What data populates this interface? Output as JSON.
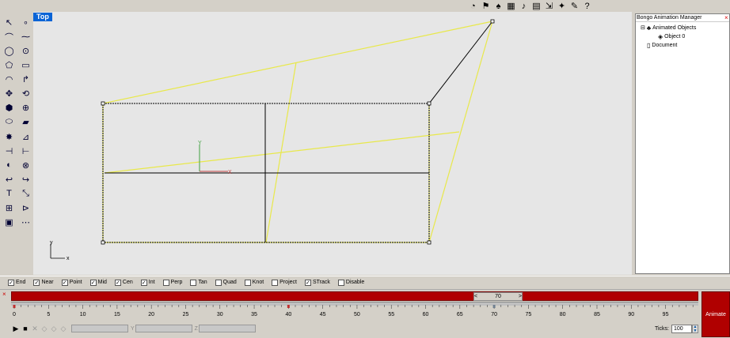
{
  "top_toolbar": {
    "icons": [
      "time-icon",
      "flag-icon",
      "camera-icon",
      "graph-icon",
      "sound-icon",
      "film-icon",
      "export-icon",
      "render-icon",
      "tools-icon",
      "help-icon"
    ],
    "glyphs": [
      "◔",
      "⚑",
      "♠",
      "▦",
      "♪",
      "▤",
      "⇲",
      "✦",
      "✎",
      "?"
    ]
  },
  "left_toolbar": {
    "icons": [
      "select-arrow-icon",
      "point-icon",
      "polyline-icon",
      "curve-points-icon",
      "circle-icon",
      "ellipse-icon",
      "polygon-icon",
      "rectangle-icon",
      "arc-icon",
      "fillet-icon",
      "move-icon",
      "rotate-icon",
      "box-icon",
      "union-icon",
      "cylinder-icon",
      "extrude-icon",
      "explode-icon",
      "dimension-icon",
      "trim-icon",
      "split-icon",
      "analyze-icon",
      "offset-icon",
      "curve-icon",
      "blend-icon",
      "text-icon",
      "transform-icon",
      "array-icon",
      "mirror-icon",
      "layer-icon",
      "grid-snap-icon"
    ],
    "glyphs": [
      "↖",
      "∘",
      "⌒",
      "⁓",
      "◯",
      "⊙",
      "⬠",
      "▭",
      "◠",
      "↱",
      "✥",
      "⟲",
      "⬢",
      "⊕",
      "⬭",
      "▰",
      "✸",
      "⊿",
      "⊣",
      "⊢",
      "◐",
      "⊗",
      "↩",
      "↪",
      "T",
      "⤡",
      "⊞",
      "⊳",
      "▣",
      "⋯"
    ]
  },
  "viewport": {
    "label": "Top",
    "axes": {
      "x_label": "x",
      "y_label": "y"
    },
    "grid_axes": {
      "x_label": "X",
      "y_label": "Y"
    },
    "colors": {
      "background": "#e6e6e6",
      "highlight": "#e8e84a",
      "geometry": "#000000",
      "x_axis": "#c04040",
      "y_axis": "#40a040"
    }
  },
  "panel": {
    "title": "Bongo Animation Manager",
    "close": "×",
    "tree": [
      {
        "label": "Animated Objects",
        "toggle": "⊟",
        "icon": "animated-objects-icon",
        "glyph": "♣",
        "level": 0
      },
      {
        "label": "Object 0",
        "toggle": "",
        "icon": "object-icon",
        "glyph": "◈",
        "level": 1
      },
      {
        "label": "Document",
        "toggle": "",
        "icon": "document-icon",
        "glyph": "▯",
        "level": 0
      }
    ]
  },
  "snap_bar": {
    "items": [
      {
        "label": "End",
        "checked": true
      },
      {
        "label": "Near",
        "checked": true
      },
      {
        "label": "Point",
        "checked": true
      },
      {
        "label": "Mid",
        "checked": true
      },
      {
        "label": "Cen",
        "checked": true
      },
      {
        "label": "Int",
        "checked": true
      },
      {
        "label": "Perp",
        "checked": false
      },
      {
        "label": "Tan",
        "checked": false
      },
      {
        "label": "Quad",
        "checked": false
      },
      {
        "label": "Knot",
        "checked": false
      },
      {
        "label": "Project",
        "checked": false
      },
      {
        "label": "STrack",
        "checked": true
      },
      {
        "label": "Disable",
        "checked": false
      }
    ]
  },
  "timeline": {
    "close": "×",
    "current_frame": "70",
    "prev": "<",
    "next": ">",
    "start": 0,
    "end": 99,
    "major_ticks": [
      0,
      5,
      10,
      15,
      20,
      25,
      30,
      35,
      40,
      45,
      50,
      55,
      60,
      65,
      70,
      75,
      80,
      85,
      90,
      95
    ],
    "keyframes": [
      0,
      40,
      70
    ],
    "animate_label": "Animate",
    "ticks_label": "Ticks:",
    "ticks_value": "100",
    "coord_labels": [
      "X",
      "Y",
      "Z"
    ],
    "colors": {
      "bar": "#b00000",
      "keyframe": "#c03030"
    }
  }
}
